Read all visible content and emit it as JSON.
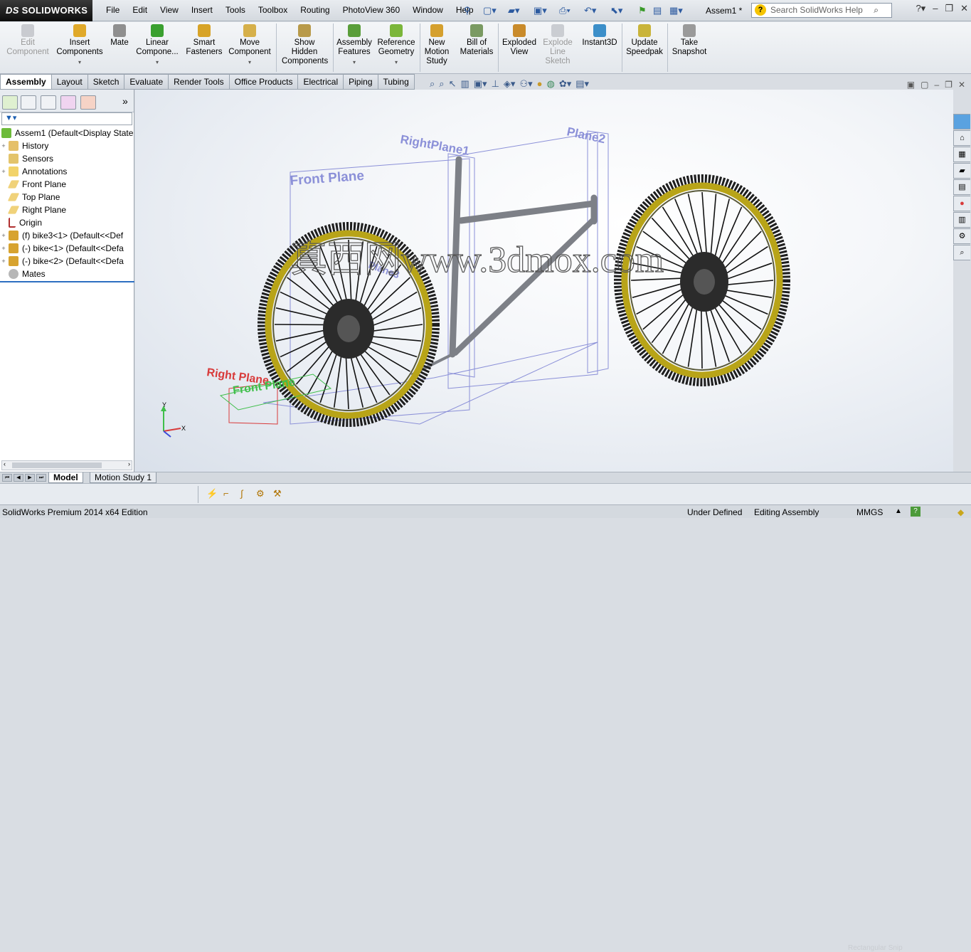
{
  "app": {
    "brand": "SOLIDWORKS",
    "brand_prefix": "DS"
  },
  "menu": [
    "File",
    "Edit",
    "View",
    "Insert",
    "Tools",
    "Toolbox",
    "Routing",
    "PhotoView 360",
    "Window",
    "Help"
  ],
  "document": {
    "title": "Assem1 *"
  },
  "help_search": {
    "placeholder": "Search SolidWorks Help"
  },
  "command_manager": [
    {
      "label": "Edit Component",
      "enabled": false,
      "icon": "edit-component-icon"
    },
    {
      "label": "Insert Components",
      "enabled": true,
      "icon": "insert-components-icon"
    },
    {
      "label": "Mate",
      "enabled": true,
      "icon": "mate-icon"
    },
    {
      "label": "Linear Compone...",
      "enabled": true,
      "icon": "linear-pattern-icon"
    },
    {
      "label": "Smart Fasteners",
      "enabled": true,
      "icon": "smart-fasteners-icon"
    },
    {
      "label": "Move Component",
      "enabled": true,
      "icon": "move-component-icon"
    },
    {
      "label": "Show Hidden Components",
      "enabled": true,
      "icon": "show-hidden-icon"
    },
    {
      "label": "Assembly Features",
      "enabled": true,
      "icon": "assembly-features-icon"
    },
    {
      "label": "Reference Geometry",
      "enabled": true,
      "icon": "reference-geometry-icon"
    },
    {
      "label": "New Motion Study",
      "enabled": true,
      "icon": "motion-study-icon"
    },
    {
      "label": "Bill of Materials",
      "enabled": true,
      "icon": "bill-of-materials-icon"
    },
    {
      "label": "Exploded View",
      "enabled": true,
      "icon": "exploded-view-icon"
    },
    {
      "label": "Explode Line Sketch",
      "enabled": false,
      "icon": "explode-line-icon"
    },
    {
      "label": "Instant3D",
      "enabled": true,
      "icon": "instant3d-icon"
    },
    {
      "label": "Update Speedpak",
      "enabled": true,
      "icon": "speedpak-icon"
    },
    {
      "label": "Take Snapshot",
      "enabled": true,
      "icon": "snapshot-icon"
    }
  ],
  "tabs": [
    "Assembly",
    "Layout",
    "Sketch",
    "Evaluate",
    "Render Tools",
    "Office Products",
    "Electrical",
    "Piping",
    "Tubing"
  ],
  "active_tab": "Assembly",
  "feature_tree": [
    {
      "label": "Assem1  (Default<Display State",
      "icon": "assembly-icon",
      "expander": ""
    },
    {
      "label": "History",
      "icon": "history-icon",
      "expander": "+"
    },
    {
      "label": "Sensors",
      "icon": "sensors-icon",
      "expander": ""
    },
    {
      "label": "Annotations",
      "icon": "annotations-icon",
      "expander": "+"
    },
    {
      "label": "Front Plane",
      "icon": "plane-icon",
      "expander": ""
    },
    {
      "label": "Top Plane",
      "icon": "plane-icon",
      "expander": ""
    },
    {
      "label": "Right Plane",
      "icon": "plane-icon",
      "expander": ""
    },
    {
      "label": "Origin",
      "icon": "origin-icon",
      "expander": ""
    },
    {
      "label": "(f) bike3<1> (Default<<Def",
      "icon": "part-icon",
      "expander": "+"
    },
    {
      "label": "(-) bike<1> (Default<<Defa",
      "icon": "part-icon",
      "expander": "+"
    },
    {
      "label": "(-) bike<2> (Default<<Defa",
      "icon": "part-icon",
      "expander": "+"
    },
    {
      "label": "Mates",
      "icon": "mates-icon",
      "expander": ""
    }
  ],
  "viewport_labels": {
    "front_plane": "Front Plane",
    "right_plane1": "RightPlane1",
    "plane2": "Plane2",
    "plane3": "Plane3",
    "right_plane": "Right Plane",
    "front_plane_small": "Front Plane",
    "watermark": "真西网www.3dmox.com",
    "triad_x": "X",
    "triad_y": "Y"
  },
  "bottom_tabs": [
    "Model",
    "Motion Study 1"
  ],
  "rect_snip": "Rectangular Snip",
  "status": {
    "edition": "SolidWorks Premium 2014 x64 Edition",
    "state": "Under Defined",
    "mode": "Editing Assembly",
    "units": "MMGS"
  },
  "colors": {
    "tire": "#2a2a2a",
    "rim": "#b8a418",
    "frame": "#8a8d93",
    "plane": "#5b63d1",
    "red": "#d83a3a",
    "green": "#3fbf4a"
  }
}
